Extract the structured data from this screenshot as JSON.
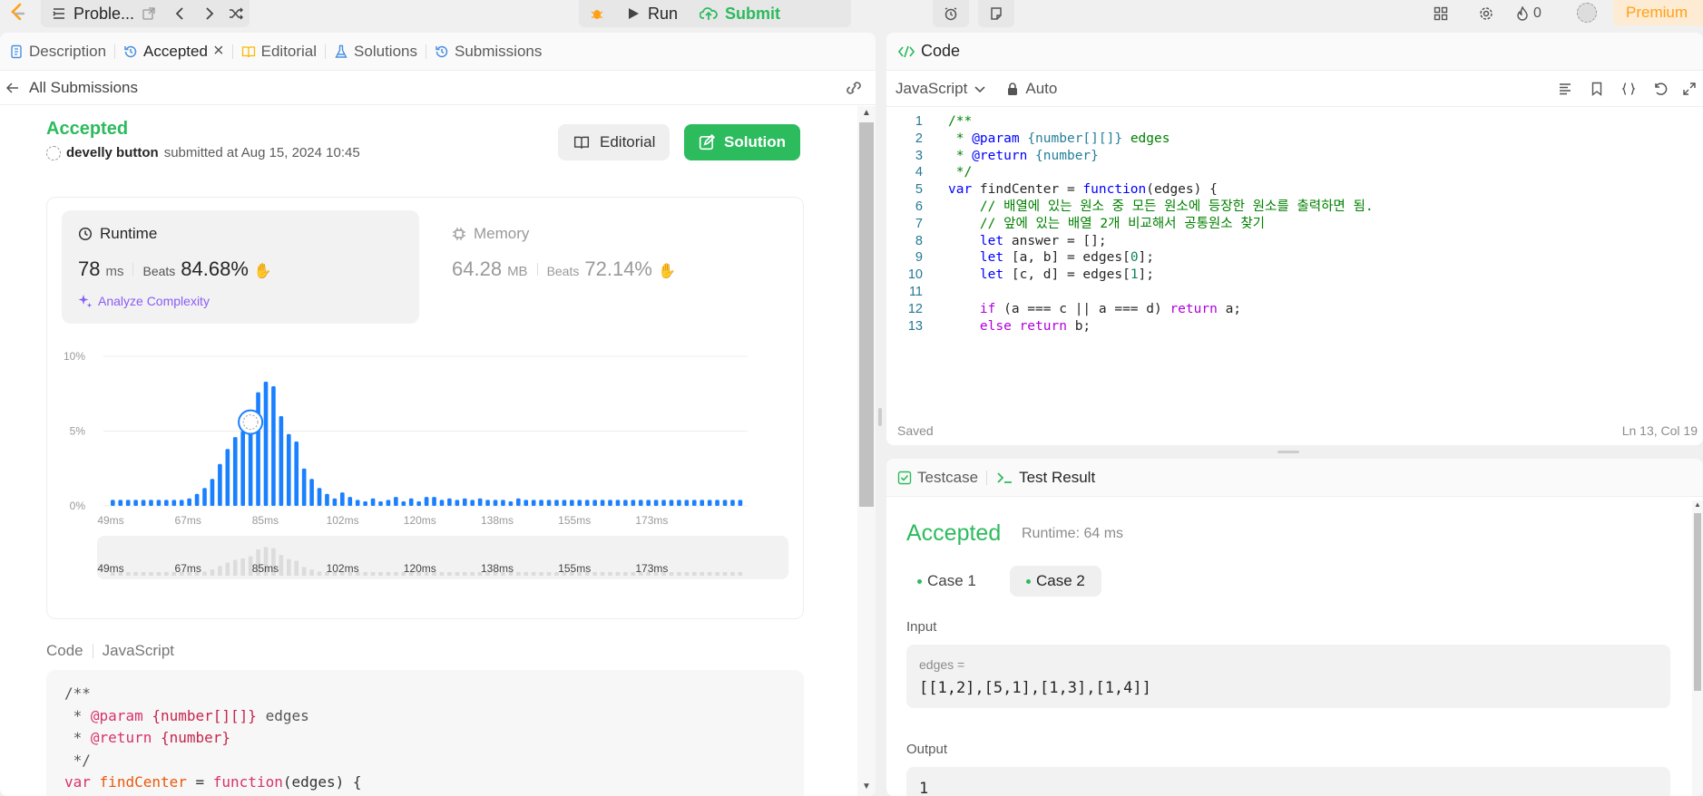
{
  "topbar": {
    "problem_label": "Proble...",
    "run_label": "Run",
    "submit_label": "Submit",
    "streak_count": "0",
    "premium_label": "Premium"
  },
  "left_tabs": {
    "description": "Description",
    "accepted": "Accepted",
    "editorial": "Editorial",
    "solutions": "Solutions",
    "submissions": "Submissions"
  },
  "back_label": "All Submissions",
  "submission": {
    "status": "Accepted",
    "user": "develly button",
    "submitted_text": "submitted at Aug 15, 2024 10:45",
    "editorial_btn": "Editorial",
    "solution_btn": "Solution"
  },
  "runtime": {
    "title": "Runtime",
    "value": "78",
    "unit": "ms",
    "beats_label": "Beats",
    "beats_value": "84.68%",
    "analyze": "Analyze Complexity"
  },
  "memory": {
    "title": "Memory",
    "value": "64.28",
    "unit": "MB",
    "beats_label": "Beats",
    "beats_value": "72.14%"
  },
  "chart_data": {
    "type": "bar",
    "title": "",
    "ylim": [
      0,
      10
    ],
    "yticks": [
      "10%",
      "5%",
      "0%"
    ],
    "xticks": [
      "49ms",
      "67ms",
      "85ms",
      "102ms",
      "120ms",
      "138ms",
      "155ms",
      "173ms"
    ],
    "values": [
      0.4,
      0.4,
      0.4,
      0.4,
      0.4,
      0.4,
      0.4,
      0.4,
      0.4,
      0.4,
      0.5,
      0.8,
      1.2,
      1.8,
      2.8,
      3.8,
      4.6,
      5.0,
      5.6,
      7.6,
      8.3,
      8.0,
      6.0,
      4.8,
      4.3,
      2.5,
      1.8,
      1.2,
      0.8,
      0.5,
      0.9,
      0.6,
      0.4,
      0.3,
      0.5,
      0.3,
      0.4,
      0.6,
      0.3,
      0.5,
      0.3,
      0.6,
      0.6,
      0.4,
      0.5,
      0.4,
      0.5,
      0.4,
      0.5,
      0.4,
      0.4,
      0.4,
      0.3,
      0.5,
      0.4,
      0.4,
      0.4,
      0.4,
      0.4,
      0.4,
      0.4,
      0.4,
      0.4,
      0.4,
      0.4,
      0.4,
      0.4,
      0.4,
      0.4,
      0.4,
      0.4,
      0.4,
      0.4,
      0.4,
      0.4,
      0.4,
      0.4,
      0.4,
      0.4,
      0.4,
      0.4,
      0.4,
      0.4
    ],
    "highlight_index": 18,
    "bar_color": "#1a80ff"
  },
  "left_code": {
    "header": "Code",
    "lang": "JavaScript",
    "lines": [
      "/**",
      " * @param {number[][]} edges",
      " * @return {number}",
      " */",
      "var findCenter = function(edges) {"
    ]
  },
  "editor": {
    "title": "Code",
    "lang": "JavaScript",
    "mode": "Auto",
    "saved": "Saved",
    "cursor": "Ln 13, Col 19",
    "lines": [
      "/**",
      " * @param {number[][]} edges",
      " * @return {number}",
      " */",
      "var findCenter = function(edges) {",
      "    // 배열에 있는 원소 중 모든 원소에 등장한 원소를 출력하면 됨.",
      "    // 앞에 있는 배열 2개 비교해서 공통원소 찾기",
      "    let answer = [];",
      "    let [a, b] = edges[0];",
      "    let [c, d] = edges[1];",
      "",
      "    if (a === c || a === d) return a;",
      "    else return b;"
    ]
  },
  "result": {
    "tab_testcase": "Testcase",
    "tab_result": "Test Result",
    "status": "Accepted",
    "runtime": "Runtime: 64 ms",
    "case1": "Case 1",
    "case2": "Case 2",
    "input_label": "Input",
    "input_var": "edges =",
    "input_value": "[[1,2],[5,1],[1,3],[1,4]]",
    "output_label": "Output",
    "output_value": "1"
  }
}
